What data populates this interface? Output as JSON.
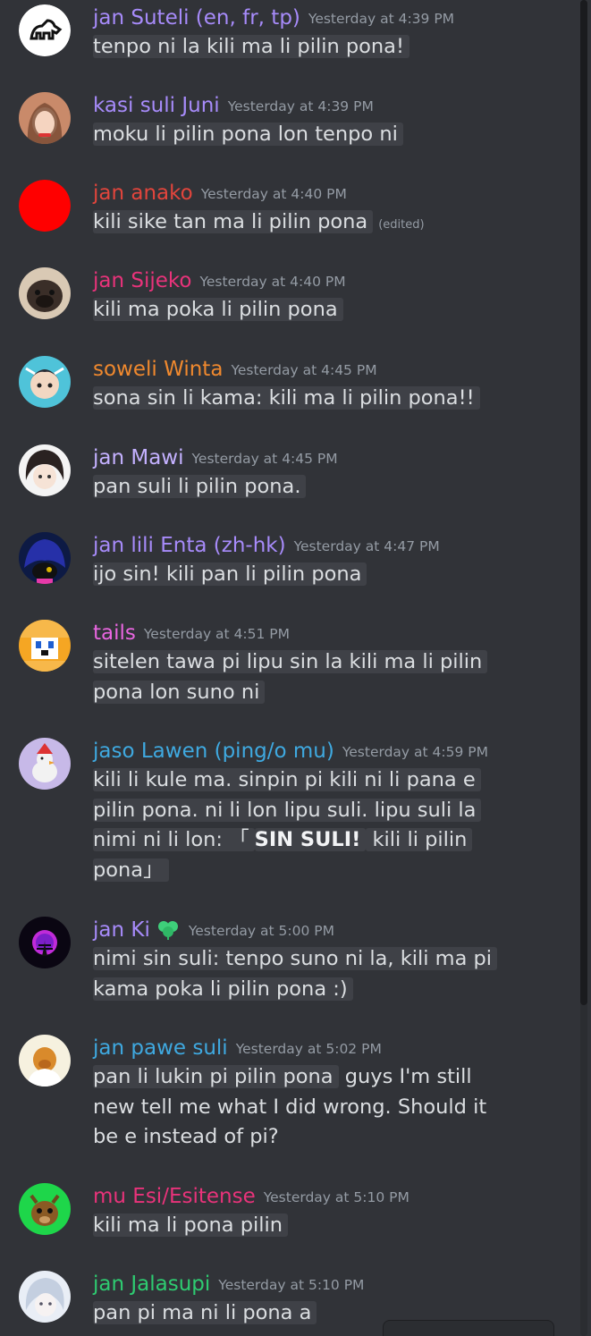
{
  "messages": [
    {
      "name": "jan Suteli (en, fr, tp)",
      "color": "#a78bfa",
      "time": "Yesterday at 4:39 PM",
      "lines": [
        [
          {
            "t": "tenpo ni la kili ma li pilin pona!",
            "hl": true
          }
        ]
      ]
    },
    {
      "name": "kasi suli Juni",
      "color": "#a78bfa",
      "time": "Yesterday at 4:39 PM",
      "lines": [
        [
          {
            "t": "moku li pilin pona lon tenpo ni",
            "hl": true
          }
        ]
      ]
    },
    {
      "name": "jan anako",
      "color": "#e2453c",
      "time": "Yesterday at 4:40 PM",
      "lines": [
        [
          {
            "t": "kili sike tan ma li pilin pona",
            "hl": true
          },
          {
            "t": "(edited)",
            "cls": "edited"
          }
        ]
      ]
    },
    {
      "name": "jan Sijeko",
      "color": "#e8337a",
      "time": "Yesterday at 4:40 PM",
      "lines": [
        [
          {
            "t": "kili ma poka li pilin pona",
            "hl": true
          }
        ]
      ]
    },
    {
      "name": "soweli Winta",
      "color": "#f0892e",
      "time": "Yesterday at 4:45 PM",
      "lines": [
        [
          {
            "t": "sona sin li kama: kili ma li pilin pona!!",
            "hl": true
          }
        ]
      ]
    },
    {
      "name": "jan Mawi",
      "color": "#c4b1ff",
      "time": "Yesterday at 4:45 PM",
      "lines": [
        [
          {
            "t": "pan suli li pilin pona.",
            "hl": true
          }
        ]
      ]
    },
    {
      "name": "jan lili Enta (zh-hk)",
      "color": "#a78bfa",
      "time": "Yesterday at 4:47 PM",
      "lines": [
        [
          {
            "t": "ijo sin! kili pan li pilin pona",
            "hl": true
          }
        ]
      ]
    },
    {
      "name": "tails",
      "color": "#e966e0",
      "time": "Yesterday at 4:51 PM",
      "lines": [
        [
          {
            "t": "sitelen tawa pi lipu sin la kili ma li pilin",
            "hl": true
          }
        ],
        [
          {
            "t": "pona lon suno ni",
            "hl": true
          }
        ]
      ]
    },
    {
      "name": "jaso Lawen (ping/o mu)",
      "color": "#3fa9e0",
      "time": "Yesterday at 4:59 PM",
      "lines": [
        [
          {
            "t": "kili li kule ma. sinpin pi kili ni li pana e",
            "hl": true
          }
        ],
        [
          {
            "t": "pilin pona. ni li lon lipu suli. lipu suli la",
            "hl": true
          }
        ],
        [
          {
            "t": "nimi ni li lon: 「",
            "hl": true
          },
          {
            "t": "SIN SULI!",
            "hl": true,
            "cls": "b"
          },
          {
            "t": " kili li pilin",
            "hl": true
          }
        ],
        [
          {
            "t": "pona」",
            "hl": true
          }
        ]
      ]
    },
    {
      "name": "jan Ki",
      "color": "#a78bfa",
      "time": "Yesterday at 5:00 PM",
      "badge": true,
      "lines": [
        [
          {
            "t": "nimi sin suli: tenpo suno ni la, kili ma pi",
            "hl": true
          }
        ],
        [
          {
            "t": "kama poka li pilin pona :)",
            "hl": true
          }
        ]
      ]
    },
    {
      "name": "jan pawe suli",
      "color": "#3fa9e0",
      "time": "Yesterday at 5:02 PM",
      "lines": [
        [
          {
            "t": "pan li lukin pi pilin pona",
            "hl": true
          },
          {
            "t": " guys I'm still"
          }
        ],
        [
          {
            "t": "new tell me what I did wrong. Should it"
          }
        ],
        [
          {
            "t": "be e instead of pi?"
          }
        ]
      ]
    },
    {
      "name": "mu Esi/Esitense",
      "color": "#e8337a",
      "time": "Yesterday at 5:10 PM",
      "lines": [
        [
          {
            "t": "kili ma li pona pilin",
            "hl": true
          }
        ]
      ]
    },
    {
      "name": "jan Jalasupi",
      "color": "#2ecc71",
      "time": "Yesterday at 5:10 PM",
      "lines": [
        [
          {
            "t": "pan pi ma ni li pona a",
            "hl": true
          }
        ]
      ]
    }
  ]
}
